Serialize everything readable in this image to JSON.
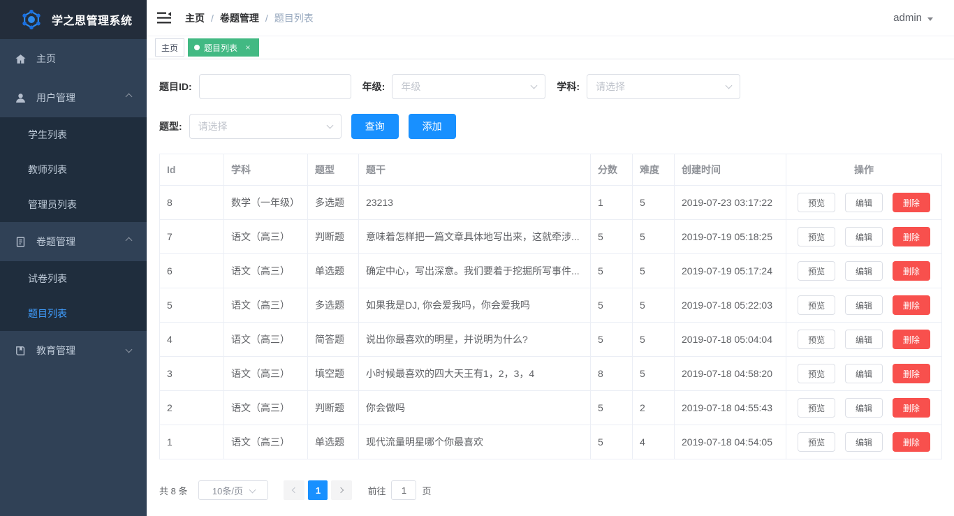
{
  "app": {
    "title": "学之思管理系统"
  },
  "colors": {
    "primary": "#1890ff",
    "danger": "#f8504d",
    "tab_active_green": "#42b983",
    "sidebar_bg": "#304156",
    "sidebar_submenu_bg": "#1f2d3d",
    "sidebar_active_text": "#409eff"
  },
  "glyphs": {
    "close": "×"
  },
  "sidebar": {
    "items": [
      {
        "label": "主页",
        "icon": "home-icon"
      },
      {
        "label": "用户管理",
        "icon": "user-icon",
        "state": "expanded",
        "children": [
          "学生列表",
          "教师列表",
          "管理员列表"
        ]
      },
      {
        "label": "卷题管理",
        "icon": "scroll-icon",
        "state": "expanded",
        "children": [
          "试卷列表",
          "题目列表"
        ]
      },
      {
        "label": "教育管理",
        "icon": "book-icon",
        "state": "collapsed"
      }
    ],
    "active_item": "题目列表"
  },
  "topbar": {
    "breadcrumb": {
      "items": [
        "主页",
        "卷题管理",
        "题目列表"
      ],
      "separator": "/"
    },
    "user": {
      "name": "admin"
    }
  },
  "tabs": [
    {
      "label": "主页",
      "active": false
    },
    {
      "label": "题目列表",
      "active": true,
      "closable": true
    }
  ],
  "filters": {
    "question_id": {
      "label": "题目ID:",
      "value": ""
    },
    "grade": {
      "label": "年级:",
      "placeholder": "年级"
    },
    "subject": {
      "label": "学科:",
      "placeholder": "请选择"
    },
    "question_type": {
      "label": "题型:",
      "placeholder": "请选择"
    },
    "search_button": "查询",
    "add_button": "添加"
  },
  "table": {
    "columns": [
      "Id",
      "学科",
      "题型",
      "题干",
      "分数",
      "难度",
      "创建时间",
      "操作"
    ],
    "actions": {
      "preview": "预览",
      "edit": "编辑",
      "delete": "删除"
    },
    "rows": [
      {
        "id": "8",
        "subject": "数学（一年级）",
        "type": "多选题",
        "stem": "23213",
        "score": "1",
        "difficulty": "5",
        "created": "2019-07-23 03:17:22"
      },
      {
        "id": "7",
        "subject": "语文（高三）",
        "type": "判断题",
        "stem": "意味着怎样把一篇文章具体地写出来，这就牵涉...",
        "score": "5",
        "difficulty": "5",
        "created": "2019-07-19 05:18:25"
      },
      {
        "id": "6",
        "subject": "语文（高三）",
        "type": "单选题",
        "stem": "确定中心，写出深意。我们要着于挖掘所写事件...",
        "score": "5",
        "difficulty": "5",
        "created": "2019-07-19 05:17:24"
      },
      {
        "id": "5",
        "subject": "语文（高三）",
        "type": "多选题",
        "stem": "如果我是DJ, 你会爱我吗，你会爱我吗",
        "score": "5",
        "difficulty": "5",
        "created": "2019-07-18 05:22:03"
      },
      {
        "id": "4",
        "subject": "语文（高三）",
        "type": "简答题",
        "stem": "说出你最喜欢的明星，并说明为什么?",
        "score": "5",
        "difficulty": "5",
        "created": "2019-07-18 05:04:04"
      },
      {
        "id": "3",
        "subject": "语文（高三）",
        "type": "填空题",
        "stem": "小时候最喜欢的四大天王有1，2，3，4",
        "score": "8",
        "difficulty": "5",
        "created": "2019-07-18 04:58:20"
      },
      {
        "id": "2",
        "subject": "语文（高三）",
        "type": "判断题",
        "stem": "你会做吗",
        "score": "5",
        "difficulty": "2",
        "created": "2019-07-18 04:55:43"
      },
      {
        "id": "1",
        "subject": "语文（高三）",
        "type": "单选题",
        "stem": "现代流量明星哪个你最喜欢",
        "score": "5",
        "difficulty": "4",
        "created": "2019-07-18 04:54:05"
      }
    ]
  },
  "pagination": {
    "total": "共 8 条",
    "page_size": "10条/页",
    "current_page": "1",
    "goto_label": "前往",
    "goto_value": "1",
    "page_label": "页"
  }
}
